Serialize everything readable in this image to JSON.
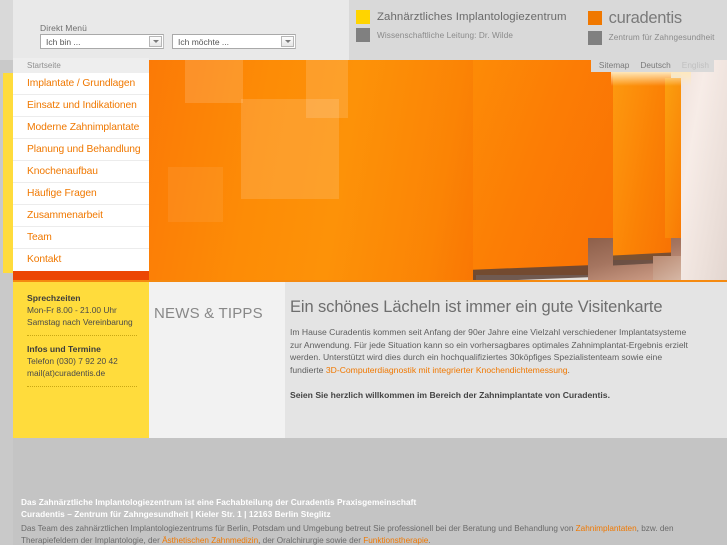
{
  "topbar": {
    "direkt_label": "Direkt Menü",
    "select_left": {
      "value": "Ich bin ...",
      "icon": "chevron-down-icon"
    },
    "select_right": {
      "value": "Ich möchte ...",
      "icon": "chevron-down-icon"
    }
  },
  "logo": {
    "left": {
      "title": "Zahnärztliches Implantologiezentrum",
      "subtitle": "Wissenschaftliche Leitung: Dr. Wilde",
      "swatch_title": "#ffd400",
      "swatch_sub": "#808080"
    },
    "right": {
      "brand": "curadentis",
      "subtitle": "Zentrum für Zahngesundheit",
      "swatch_brand": "#f07800",
      "swatch_sub": "#808080"
    }
  },
  "toplinks": {
    "sitemap": "Sitemap",
    "deutsch": "Deutsch",
    "english": "English"
  },
  "breadcrumb": "Startseite",
  "nav": {
    "items": [
      {
        "label": "Implantate / Grundlagen"
      },
      {
        "label": "Einsatz und Indikationen"
      },
      {
        "label": "Moderne Zahnimplantate"
      },
      {
        "label": "Planung und Behandlung"
      },
      {
        "label": "Knochenaufbau"
      },
      {
        "label": "Häufige Fragen"
      },
      {
        "label": "Zusammenarbeit"
      },
      {
        "label": "Team"
      },
      {
        "label": "Kontakt"
      }
    ],
    "accent_color": "#f07800",
    "strip_color": "#ffdc3c"
  },
  "infobox": {
    "heading1": "Sprechzeiten",
    "line1a": "Mon-Fr 8.00 - 21.00 Uhr",
    "line1b": "Samstag nach Vereinbarung",
    "heading2": "Infos und Termine",
    "line2a": "Telefon (030) 7 92 20 42",
    "line2b": "mail(at)curadentis.de"
  },
  "news": {
    "title": "NEWS & TIPPS"
  },
  "main": {
    "heading": "Ein schönes Lächeln ist immer ein gute Visitenkarte",
    "paragraph_before": "Im Hause Curadentis kommen seit Anfang der 90er Jahre eine Vielzahl verschiedener Implantatsysteme zur Anwendung. Für jede Situation kann so ein vorhersagbares optimales Zahnimplantat-Ergebnis erzielt werden. Unterstützt wird dies durch ein hochqualifiziertes 30köpfiges Spezialistenteam sowie eine fundierte ",
    "paragraph_link": "3D-Computerdiagnostik mit integrierter Knochendichtemessung",
    "paragraph_after": ".",
    "bold_line": "Seien Sie herzlich willkommen im Bereich der Zahnimplantate von Curadentis."
  },
  "footer": {
    "line1": "Das Zahnärztliche Implantologiezentrum ist eine Fachabteilung der Curadentis Praxisgemeinschaft",
    "line2": "Curadentis – Zentrum für Zahngesundheit  |  Kieler Str. 1  |  12163 Berlin Steglitz",
    "body_1": "Das Team des zahnärztlichen Implantologiezentrums für Berlin, Potsdam und Umgebung betreut Sie professionell bei der Beratung und Behandlung von ",
    "link_1": "Zahnimplantaten",
    "body_2": ", bzw. den Therapiefeldern der Implantologie, der ",
    "link_2": "Ästhetischen Zahnmedizin",
    "body_3": ", der Oralchirurgie sowie der ",
    "link_3": "Funktionstherapie",
    "body_4": "."
  },
  "hero": {
    "alt": "orange-corridor-photo"
  }
}
